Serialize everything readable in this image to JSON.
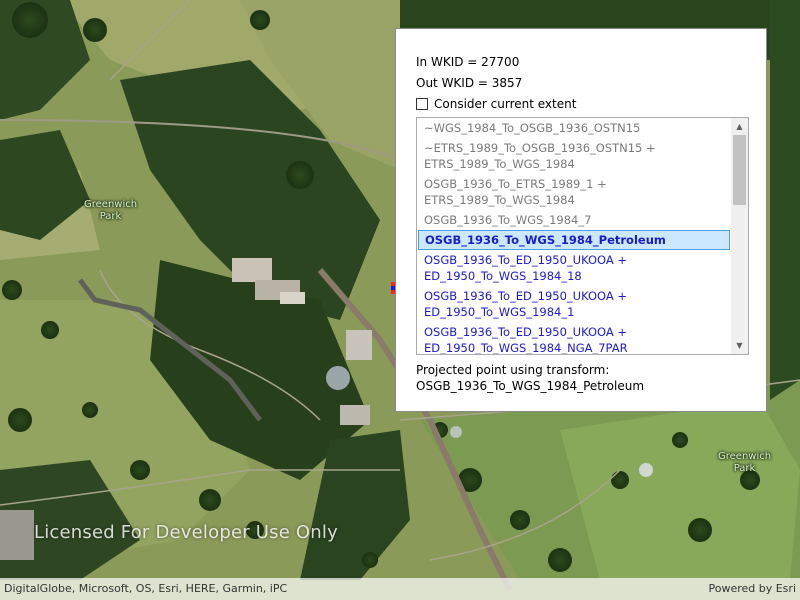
{
  "map": {
    "labels": [
      {
        "text": "Greenwich\nPark"
      },
      {
        "text": "Greenwich\nPark"
      }
    ],
    "watermark": "Licensed For Developer Use Only",
    "attribution_left": "DigitalGlobe, Microsoft, OS, Esri, HERE, Garmin, iPC",
    "attribution_right": "Powered by Esri"
  },
  "panel": {
    "in_wkid": "In WKID = 27700",
    "out_wkid": "Out WKID = 3857",
    "checkbox_label": "Consider current extent",
    "checkbox_checked": false,
    "transforms": [
      {
        "text": "~WGS_1984_To_OSGB_1936_OSTN15",
        "style": "grey"
      },
      {
        "text": "~ETRS_1989_To_OSGB_1936_OSTN15 +\nETRS_1989_To_WGS_1984",
        "style": "grey"
      },
      {
        "text": "OSGB_1936_To_ETRS_1989_1 +\nETRS_1989_To_WGS_1984",
        "style": "grey"
      },
      {
        "text": "OSGB_1936_To_WGS_1984_7",
        "style": "grey"
      },
      {
        "text": "OSGB_1936_To_WGS_1984_Petroleum",
        "style": "selected"
      },
      {
        "text": "OSGB_1936_To_ED_1950_UKOOA +\nED_1950_To_WGS_1984_18",
        "style": "blue"
      },
      {
        "text": "OSGB_1936_To_ED_1950_UKOOA +\nED_1950_To_WGS_1984_1",
        "style": "blue"
      },
      {
        "text": "OSGB_1936_To_ED_1950_UKOOA +\nED_1950_To_WGS_1984_NGA_7PAR",
        "style": "blue"
      }
    ],
    "projected_label": "Projected point using transform:",
    "projected_value": "OSGB_1936_To_WGS_1984_Petroleum"
  },
  "icons": {
    "scroll_up": "chevron-up-icon",
    "scroll_down": "chevron-down-icon"
  }
}
